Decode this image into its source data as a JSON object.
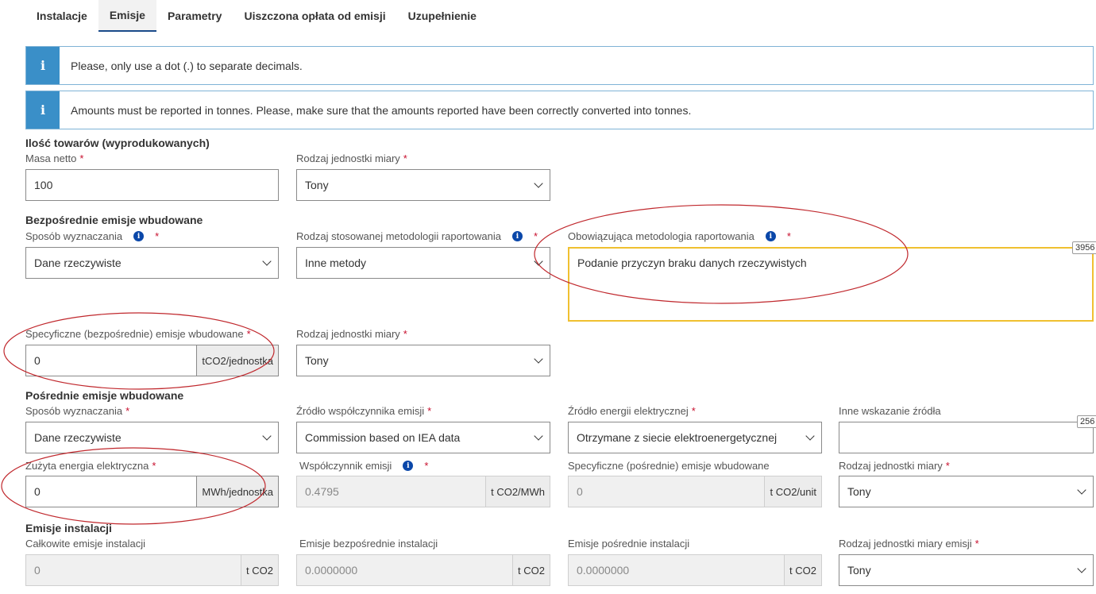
{
  "tabs": [
    "Instalacje",
    "Emisje",
    "Parametry",
    "Uiszczona opłata od emisji",
    "Uzupełnienie"
  ],
  "info": [
    "Please, only use a dot (.) to separate decimals.",
    "Amounts must be reported in tonnes. Please, make sure that the amounts reported have been correctly converted into tonnes."
  ],
  "info_icon": "i",
  "goods": {
    "title": "Ilość towarów (wyprodukowanych)",
    "net_mass_label": "Masa netto",
    "net_mass_value": "100",
    "unit_label": "Rodzaj jednostki miary",
    "unit_value": "Tony"
  },
  "direct": {
    "title": "Bezpośrednie emisje wbudowane",
    "method_label": "Sposób wyznaczania",
    "method_value": "Dane rzeczywiste",
    "methodology_type_label": "Rodzaj stosowanej metodologii raportowania",
    "methodology_type_value": "Inne metody",
    "applicable_label": "Obowiązująca metodologia raportowania",
    "applicable_value": "Podanie przyczyn braku danych rzeczywistych",
    "applicable_counter": "3956",
    "specific_label": "Specyficzne (bezpośrednie) emisje wbudowane",
    "specific_value": "0",
    "specific_unit": "tCO2/jednostka",
    "unit_label": "Rodzaj jednostki miary",
    "unit_value": "Tony"
  },
  "indirect": {
    "title": "Pośrednie emisje wbudowane",
    "method_label": "Sposób wyznaczania",
    "method_value": "Dane rzeczywiste",
    "factor_source_label": "Źródło współczynnika emisji",
    "factor_source_value": "Commission based on IEA data",
    "electricity_source_label": "Źródło energii elektrycznej",
    "electricity_source_value": "Otrzymane z siecie elektroenergetycznej",
    "other_source_label": "Inne wskazanie źródła",
    "other_source_value": "",
    "other_source_counter": "256",
    "consumed_label": "Zużyta energia elektryczna",
    "consumed_value": "0",
    "consumed_unit": "MWh/jednostka",
    "factor_label": "Współczynnik emisji",
    "factor_value": "0.4795",
    "factor_unit": "t CO2/MWh",
    "specific_label": "Specyficzne (pośrednie) emisje wbudowane",
    "specific_value": "0",
    "specific_unit": "t CO2/unit",
    "unit_label": "Rodzaj jednostki miary",
    "unit_value": "Tony"
  },
  "installation": {
    "title": "Emisje instalacji",
    "total_label": "Całkowite emisje instalacji",
    "total_value": "0",
    "total_unit": "t CO2",
    "direct_label": "Emisje bezpośrednie instalacji",
    "direct_value": "0.0000000",
    "direct_unit": "t CO2",
    "indirect_label": "Emisje pośrednie instalacji",
    "indirect_value": "0.0000000",
    "indirect_unit": "t CO2",
    "unit_label": "Rodzaj jednostki miary emisji",
    "unit_value": "Tony"
  },
  "required_mark": "*",
  "colors": {
    "accent": "#1a4a8a",
    "info_icon_bg": "#3a8fc8",
    "required": "#c8102e",
    "annotation": "#c0282d",
    "highlight_border": "#f0c030"
  }
}
